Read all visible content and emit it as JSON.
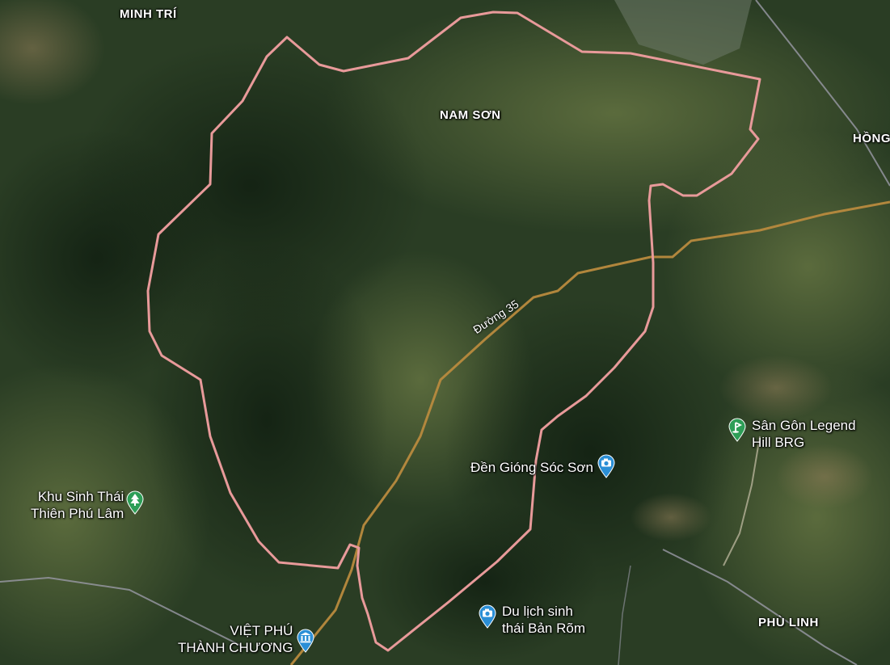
{
  "map": {
    "view": "satellite",
    "colors": {
      "boundary": "#e89a9a",
      "road": "#b88a3e",
      "admin_line": "#9a9aa6",
      "pin_green": "#2e9e57",
      "pin_blue": "#2b8fd6"
    },
    "area_labels": {
      "minh_tri": "MINH TRÍ",
      "nam_son": "NAM SƠN",
      "hong": "HỒNG",
      "phu_linh": "PHÙ LINH"
    },
    "road_label": "Đường 35",
    "pois": {
      "golf": {
        "line1": "Sân Gôn Legend",
        "line2": "Hill BRG",
        "icon": "golf-icon"
      },
      "den_giong": {
        "line1": "Đền Gióng Sóc Sơn",
        "icon": "camera-icon"
      },
      "khu_sinh_thai": {
        "line1": "Khu Sinh Thái",
        "line2": "Thiên Phú Lâm",
        "icon": "tree-icon"
      },
      "du_lich": {
        "line1": "Du lịch sinh",
        "line2": "thái Bản Rõm",
        "icon": "camera-icon"
      },
      "viet_phu": {
        "line1": "VIỆT PHÚ",
        "line2": "THÀNH CHƯƠNG",
        "icon": "museum-icon"
      }
    }
  }
}
